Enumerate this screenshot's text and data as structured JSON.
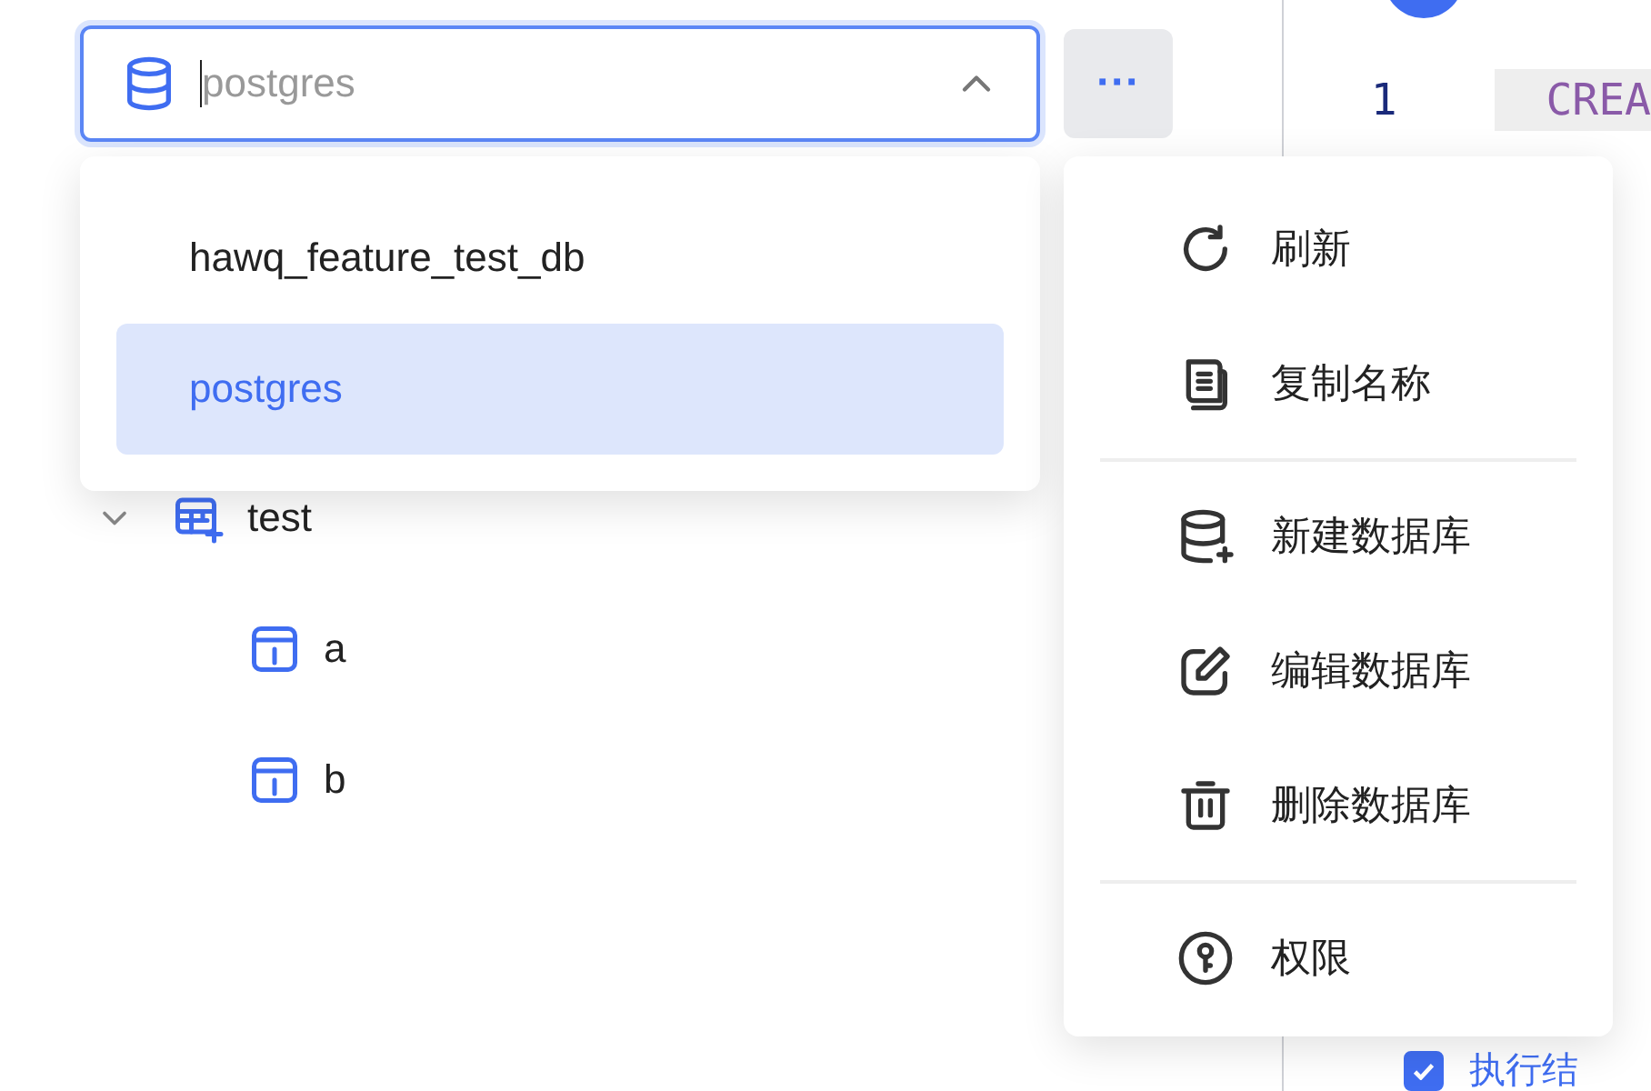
{
  "database_select": {
    "value": "postgres",
    "expanded": true
  },
  "database_options": [
    {
      "label": "hawq_feature_test_db",
      "selected": false
    },
    {
      "label": "postgres",
      "selected": true
    }
  ],
  "more_button": {
    "label": "···"
  },
  "tree": [
    {
      "label": "test",
      "kind": "schema",
      "expanded": true,
      "children": [
        {
          "label": "a",
          "kind": "table"
        },
        {
          "label": "b",
          "kind": "table"
        }
      ]
    }
  ],
  "context_menu": [
    [
      {
        "label": "刷新",
        "kind": "refresh"
      },
      {
        "label": "复制名称",
        "kind": "copy"
      }
    ],
    [
      {
        "label": "新建数据库",
        "kind": "new-db"
      },
      {
        "label": "编辑数据库",
        "kind": "edit"
      },
      {
        "label": "删除数据库",
        "kind": "delete"
      }
    ],
    [
      {
        "label": "权限",
        "kind": "permission"
      }
    ]
  ],
  "editor": {
    "line_number": "1",
    "code": "CREA"
  },
  "results_tab": {
    "label": "执行结",
    "checked": true
  }
}
